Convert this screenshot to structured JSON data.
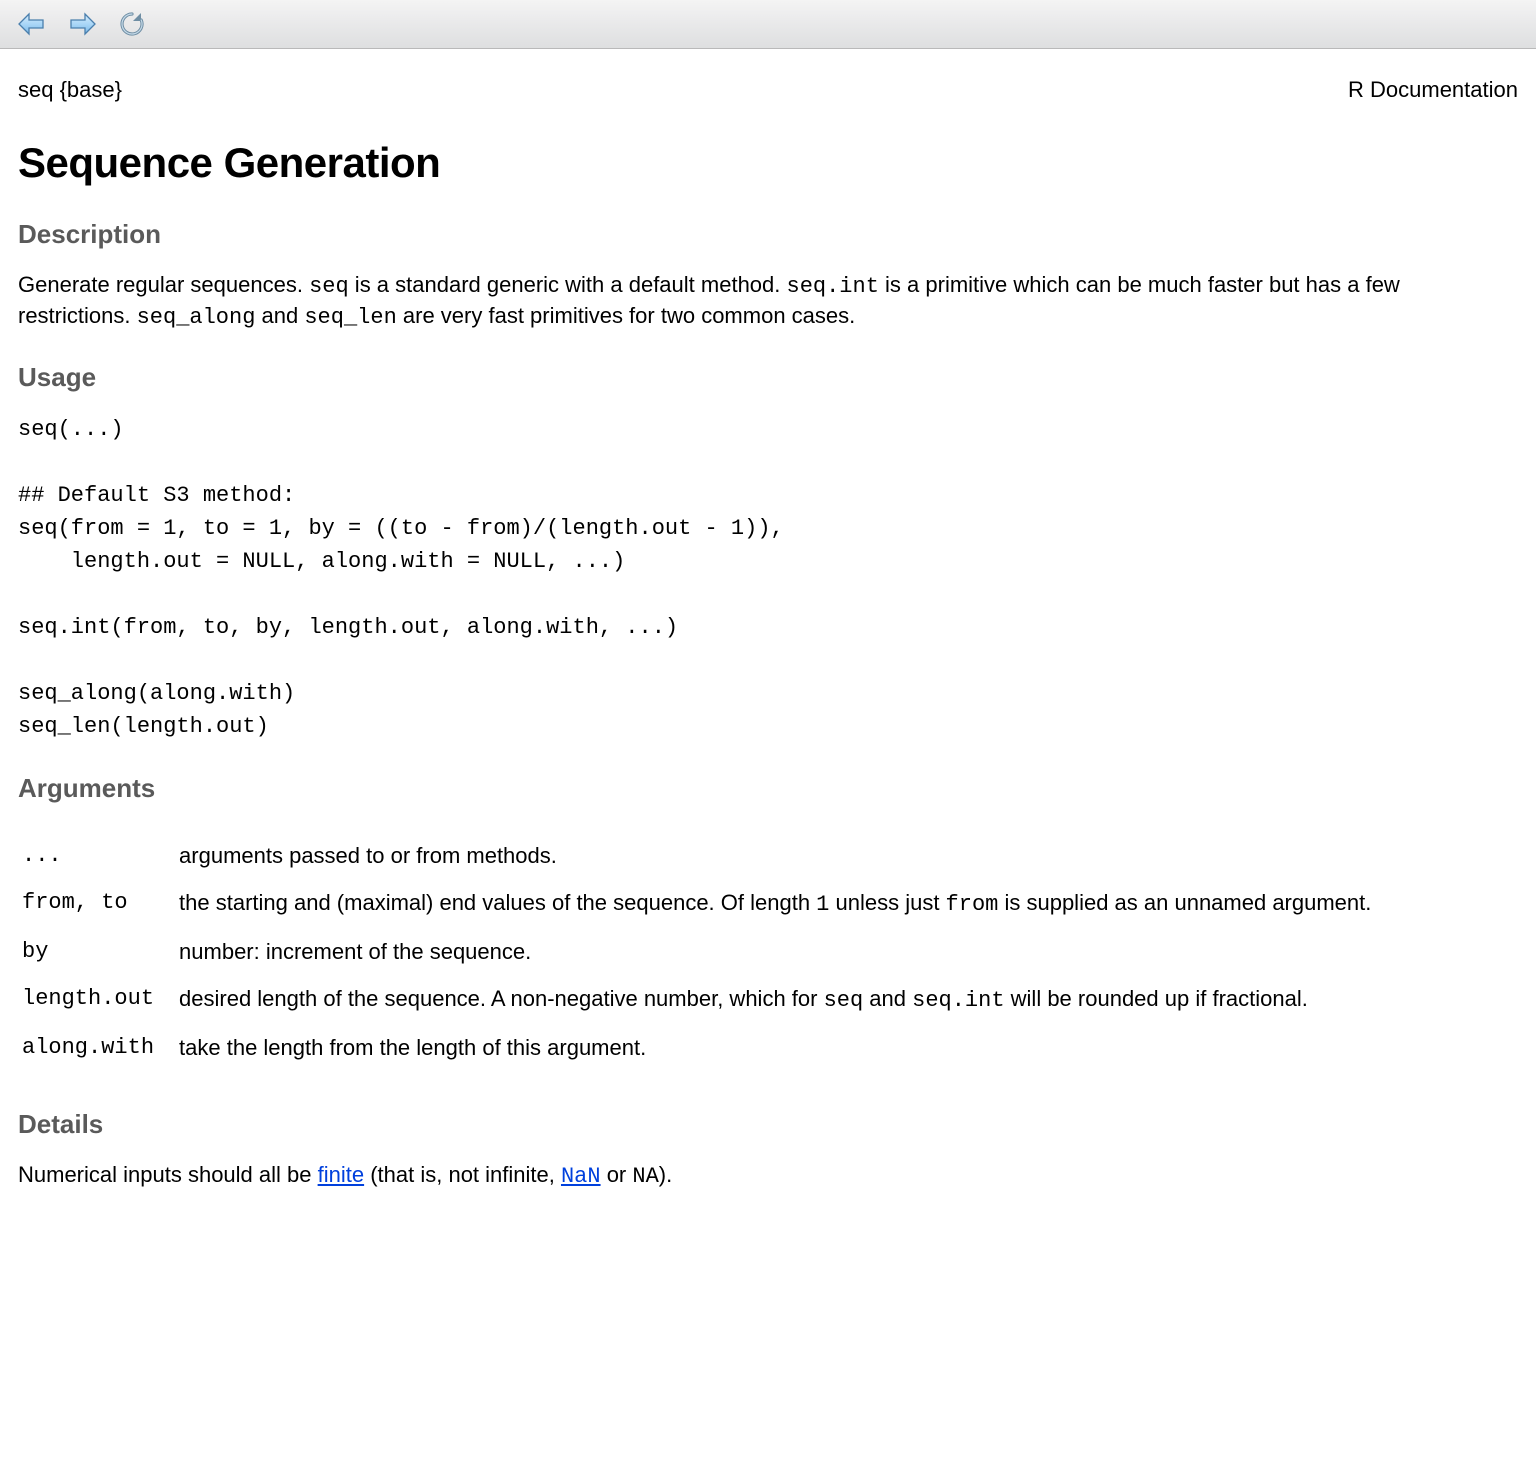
{
  "meta": {
    "topic_package": "seq {base}",
    "rdoc_label": "R Documentation"
  },
  "title": "Sequence Generation",
  "sections": {
    "description": "Description",
    "usage": "Usage",
    "arguments": "Arguments",
    "details": "Details"
  },
  "description": {
    "pre_seq": "Generate regular sequences. ",
    "seq": "seq",
    "aft_seq": " is a standard generic with a default method. ",
    "seq_int": "seq.int",
    "aft_seq_int": " is a primitive which can be much faster but has a few restrictions. ",
    "seq_along": "seq_along",
    "and": " and ",
    "seq_len": "seq_len",
    "tail": " are very fast primitives for two common cases."
  },
  "usage_code": "seq(...)\n\n## Default S3 method:\nseq(from = 1, to = 1, by = ((to - from)/(length.out - 1)),\n    length.out = NULL, along.with = NULL, ...)\n\nseq.int(from, to, by, length.out, along.with, ...)\n\nseq_along(along.with)\nseq_len(length.out)",
  "arguments": [
    {
      "name": "...",
      "desc_plain": "arguments passed to or from methods."
    },
    {
      "name": "from, to",
      "desc_pre": "the starting and (maximal) end values of the sequence. Of length ",
      "code1": "1",
      "desc_mid": " unless just ",
      "code2": "from",
      "desc_post": " is supplied as an unnamed argument."
    },
    {
      "name": "by",
      "desc_plain": "number: increment of the sequence."
    },
    {
      "name": "length.out",
      "desc_pre": "desired length of the sequence. A non-negative number, which for ",
      "code1": "seq",
      "desc_mid": " and ",
      "code2": "seq.int",
      "desc_post": " will be rounded up if fractional."
    },
    {
      "name": "along.with",
      "desc_plain": "take the length from the length of this argument."
    }
  ],
  "details": {
    "pre": "Numerical inputs should all be ",
    "link1": "finite",
    "mid1": " (that is, not infinite, ",
    "link2": "NaN",
    "mid2": " or ",
    "code1": "NA",
    "post": ")."
  },
  "icons": {
    "back": "back-arrow",
    "forward": "forward-arrow",
    "reload": "reload"
  }
}
